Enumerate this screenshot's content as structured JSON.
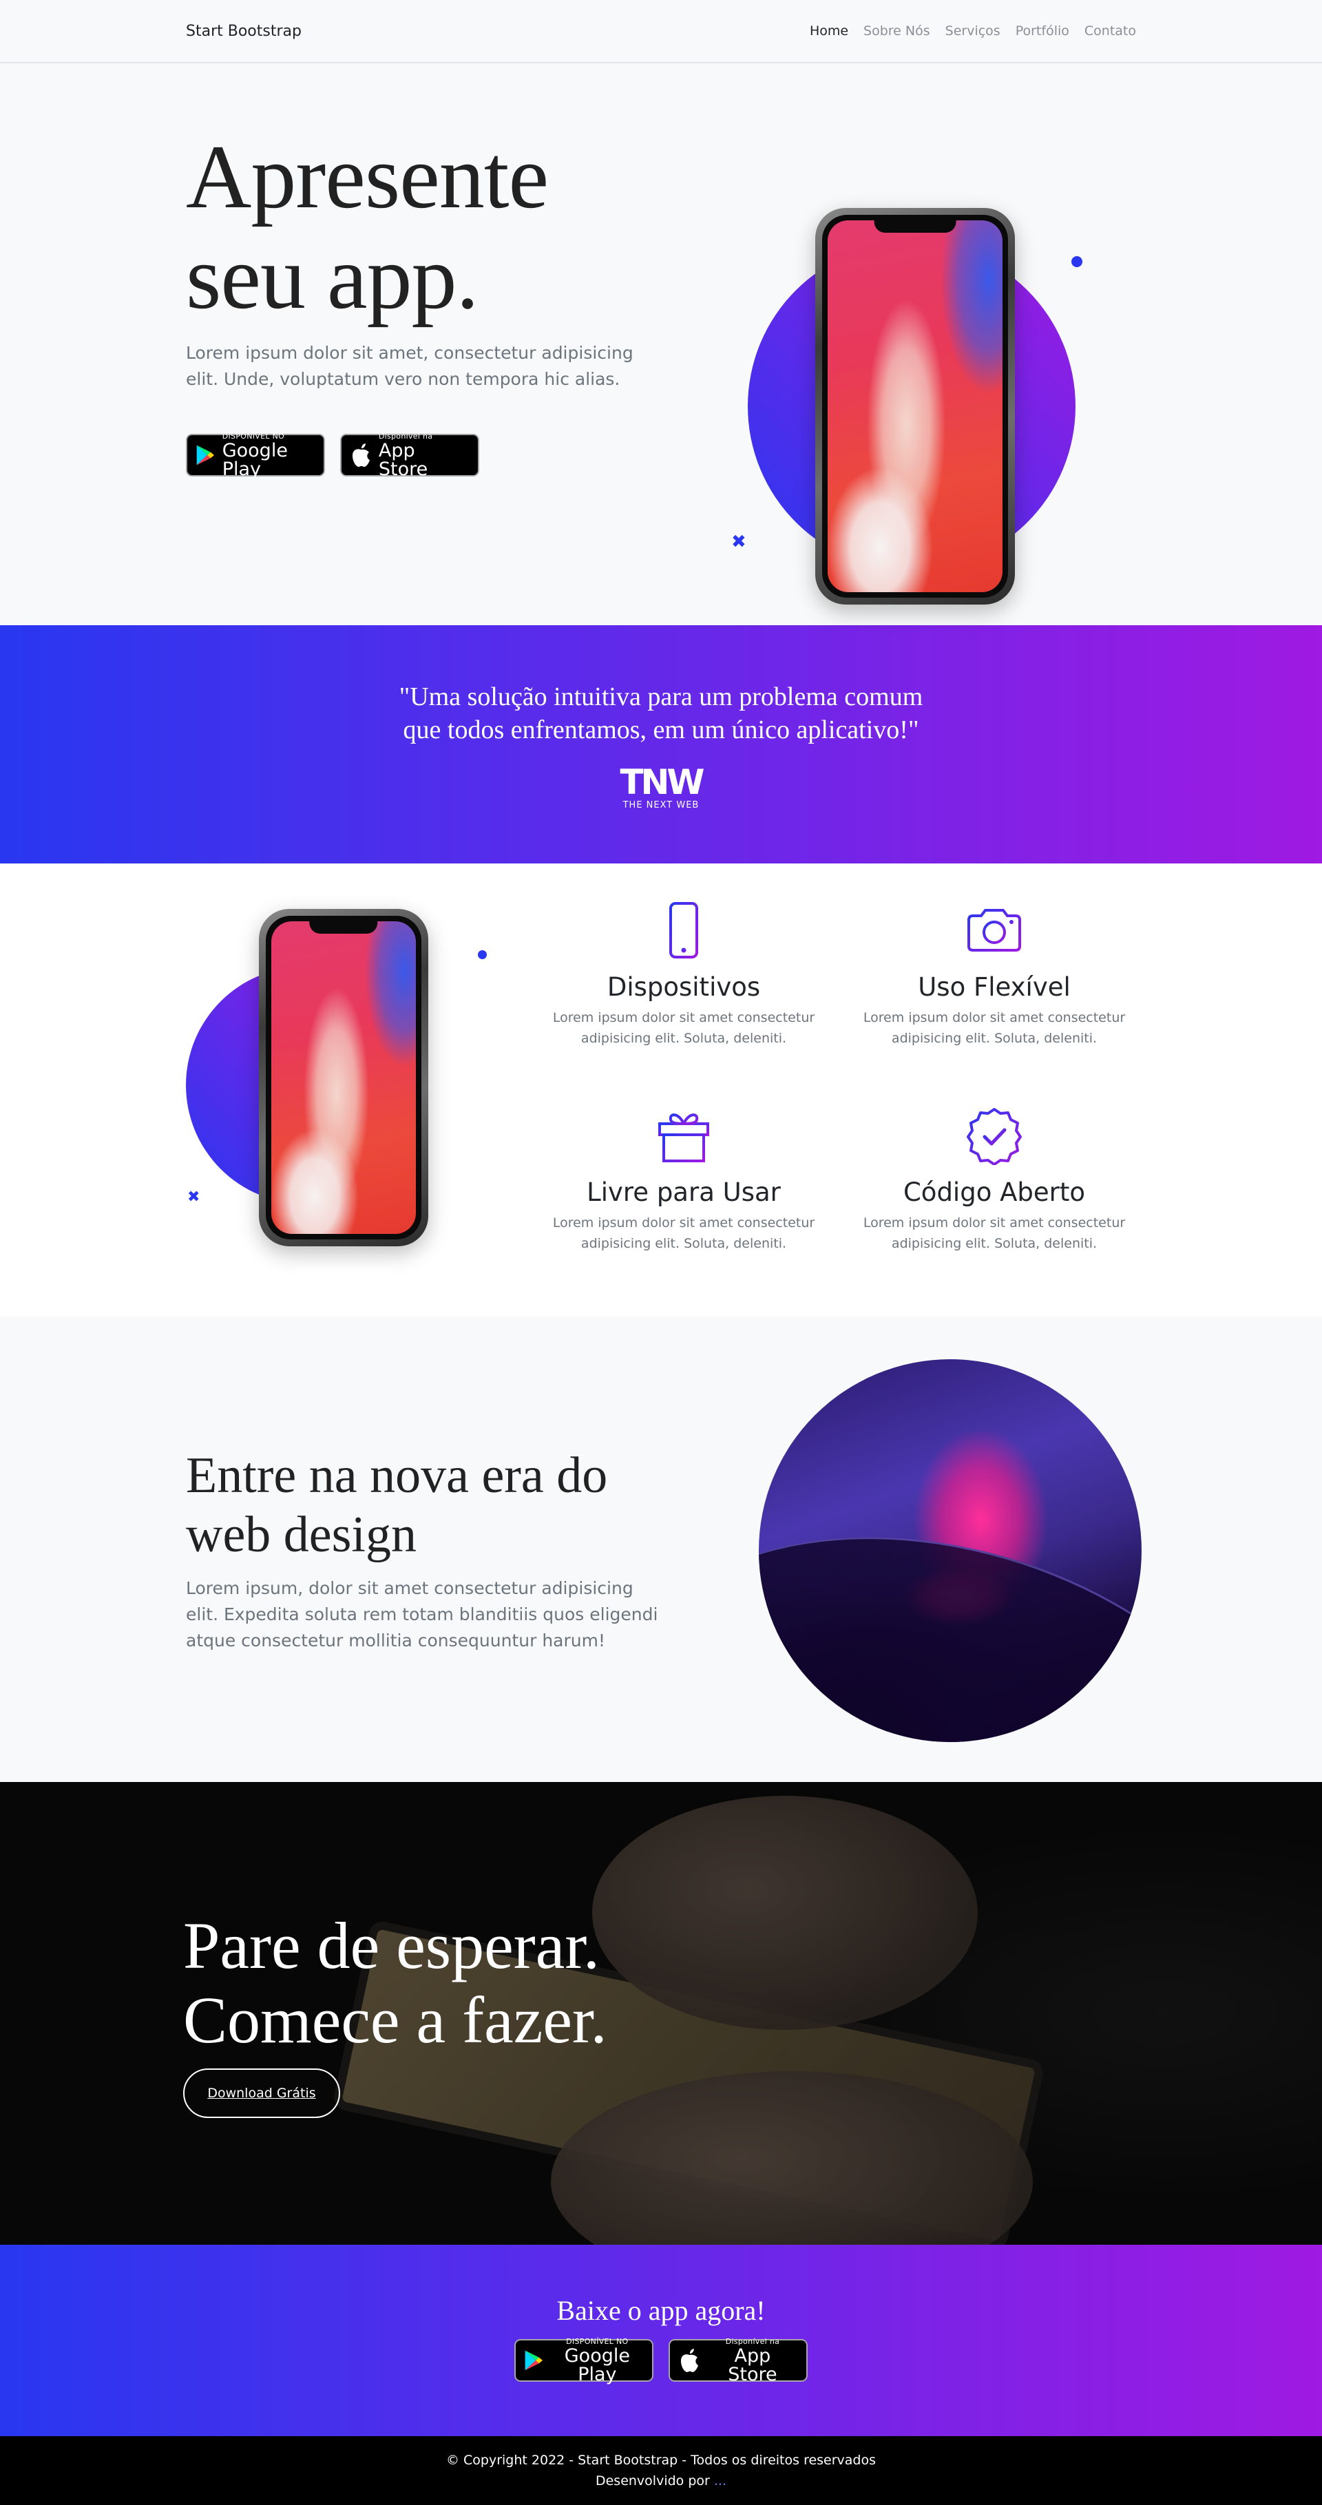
{
  "nav": {
    "brand": "Start Bootstrap",
    "links": [
      "Home",
      "Sobre Nós",
      "Serviços",
      "Portfólio",
      "Contato"
    ]
  },
  "hero": {
    "title_line1": "Apresente",
    "title_line2": "seu app.",
    "lead": "Lorem ipsum dolor sit amet, consectetur adipisicing elit. Unde, voluptatum vero non tempora hic alias."
  },
  "store": {
    "google_small": "DISPONÍVEL NO",
    "google_big": "Google Play",
    "apple_small": "Disponível na",
    "apple_big": "App Store"
  },
  "quote": {
    "line1": "\"Uma solução intuitiva para um problema comum",
    "line2": "que todos enfrentamos, em um único aplicativo!\"",
    "logo": "TNW",
    "logo_sub": "THE NEXT WEB"
  },
  "features": [
    {
      "icon": "phone-icon",
      "title": "Dispositivos",
      "text": "Lorem ipsum dolor sit amet consectetur adipisicing elit. Soluta, deleniti."
    },
    {
      "icon": "camera-icon",
      "title": "Uso Flexível",
      "text": "Lorem ipsum dolor sit amet consectetur adipisicing elit. Soluta, deleniti."
    },
    {
      "icon": "gift-icon",
      "title": "Livre para Usar",
      "text": "Lorem ipsum dolor sit amet consectetur adipisicing elit. Soluta, deleniti."
    },
    {
      "icon": "patch-check-icon",
      "title": "Código Aberto",
      "text": "Lorem ipsum dolor sit amet consectetur adipisicing elit. Soluta, deleniti."
    }
  ],
  "webdesign": {
    "title_line1": "Entre na nova era do",
    "title_line2": "web design",
    "text": "Lorem ipsum, dolor sit amet consectetur adipisicing elit. Expedita soluta rem totam blanditiis quos eligendi atque consectetur mollitia consequuntur harum!"
  },
  "cta": {
    "title_line1": "Pare de esperar.",
    "title_line2": "Comece a fazer.",
    "button": "Download Grátis"
  },
  "download": {
    "title": "Baixe o app agora!"
  },
  "footer": {
    "copyright": "© Copyright 2022 - Start Bootstrap - Todos os direitos reservados",
    "dev_label": "Desenvolvido por",
    "dev_link": "..."
  },
  "colors": {
    "gradient_start": "#2937f0",
    "gradient_end": "#9f1ae2",
    "text_dark": "#212529",
    "text_muted": "#6c757d"
  }
}
